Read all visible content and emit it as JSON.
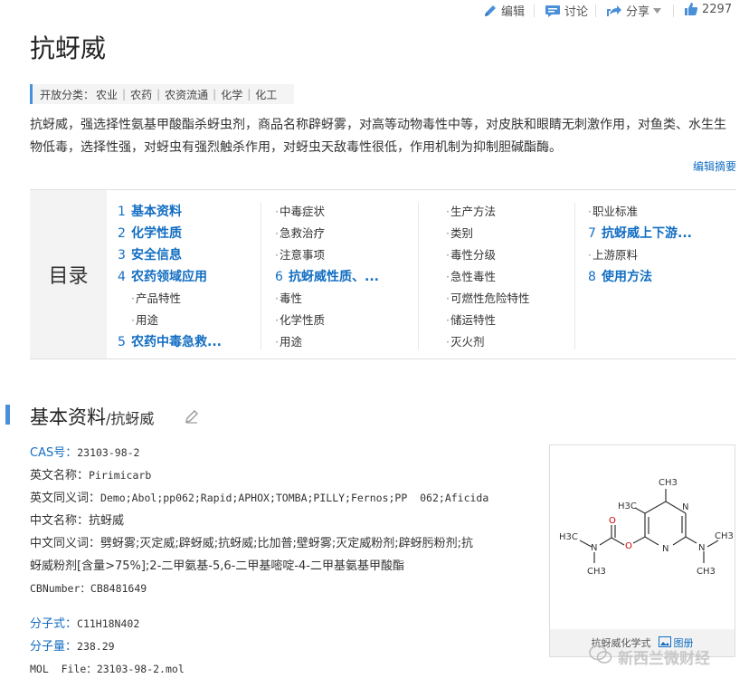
{
  "toolbar": {
    "edit_label": "编辑",
    "discuss_label": "讨论",
    "share_label": "分享",
    "like_count": "2297"
  },
  "title": "抗蚜威",
  "categories": {
    "label": "开放分类：",
    "items": [
      "农业",
      "农药",
      "农资流通",
      "化学",
      "化工"
    ]
  },
  "summary": "抗蚜威，强选择性氨基甲酸酯杀蚜虫剂，商品名称辟蚜雾，对高等动物毒性中等，对皮肤和眼睛无刺激作用，对鱼类、水生生物低毒，选择性强，对蚜虫有强烈触杀作用，对蚜虫天敌毒性很低，作用机制为抑制胆碱酯酶。",
  "edit_summary": "编辑摘要",
  "catalog": {
    "heading": "目录",
    "columns": [
      [
        {
          "num": "1",
          "label": "基本资料"
        },
        {
          "num": "2",
          "label": "化学性质"
        },
        {
          "num": "3",
          "label": "安全信息"
        },
        {
          "num": "4",
          "label": "农药领域应用"
        },
        {
          "label": "产品特性"
        },
        {
          "label": "用途"
        },
        {
          "num": "5",
          "label": "农药中毒急救..."
        }
      ],
      [
        {
          "label": "中毒症状"
        },
        {
          "label": "急救治疗"
        },
        {
          "label": "注意事项"
        },
        {
          "num": "6",
          "label": "抗蚜威性质、..."
        },
        {
          "label": "毒性"
        },
        {
          "label": "化学性质"
        },
        {
          "label": "用途"
        }
      ],
      [
        {
          "label": "生产方法"
        },
        {
          "label": "类别"
        },
        {
          "label": "毒性分级"
        },
        {
          "label": "急性毒性"
        },
        {
          "label": "可燃性危险特性"
        },
        {
          "label": "储运特性"
        },
        {
          "label": "灭火剂"
        }
      ],
      [
        {
          "label": "职业标准"
        },
        {
          "num": "7",
          "label": "抗蚜威上下游..."
        },
        {
          "label": "上游原料"
        },
        {
          "num": "8",
          "label": "使用方法"
        }
      ]
    ]
  },
  "section": {
    "title": "基本资料",
    "subtitle": "/抗蚜威"
  },
  "basic_info": {
    "cas_key": "CAS号：",
    "cas_val": "23103-98-2",
    "en_name_key": "英文名称：",
    "en_name_val": "Pirimicarb",
    "en_syn_key": "英文同义词：",
    "en_syn_val": "Demo;Abol;pp062;Rapid;APHOX;TOMBA;PILLY;Fernos;PP  062;Aficida",
    "cn_name_key": "中文名称：",
    "cn_name_val": "抗蚜威",
    "cn_syn_key": "中文同义词：",
    "cn_syn_val1": "劈蚜雾;灭定威;辟蚜威;抗蚜威;比加普;壁蚜雾;灭定威粉剂;辟蚜肟粉剂;抗",
    "cn_syn_val2": "蚜威粉剂[含量>75%];2-二甲氨基-5,6-二甲基嘧啶-4-二甲基氨基甲酸酯",
    "cbn_key": "CBNumber：",
    "cbn_val": "CB8481649",
    "formula_key": "分子式：",
    "formula_val": "C11H18N402",
    "mw_key": "分子量：",
    "mw_val": "238.29",
    "mol_key": "MOL  File：",
    "mol_val": "23103-98-2.mol"
  },
  "structure": {
    "caption": "抗蚜威化学式",
    "view_label": "图册",
    "atoms": [
      "N",
      "N",
      "N",
      "N",
      "O",
      "O",
      "CH3",
      "CH3",
      "CH3",
      "CH3",
      "H3C",
      "H3C"
    ]
  },
  "watermark": "新西兰微财经",
  "colors": {
    "link": "#136ec2",
    "accent": "#4a90d9"
  }
}
